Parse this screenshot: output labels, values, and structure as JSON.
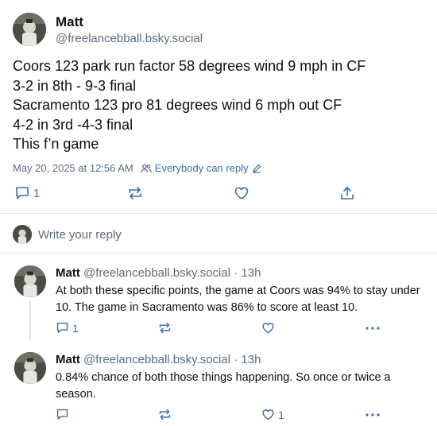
{
  "main_post": {
    "display_name": "Matt",
    "handle": "@freelancebball.bsky.social",
    "lines": [
      "Coors 123 park run factor 58 degrees wind 9 mph in CF",
      "3-2 in 8th - 9-3 final",
      "Sacramento 123 pro 81 degrees wind 6 mph out CF",
      "4-2 in 3rd -4-3 final",
      "This f’n game"
    ],
    "timestamp": "May 20, 2025 at 12:56 AM",
    "reply_permission": "Everybody can reply",
    "reply_count": "1"
  },
  "composer": {
    "placeholder": "Write your reply"
  },
  "replies": [
    {
      "display_name": "Matt",
      "handle": "@freelancebball.bsky.social",
      "age": "· 13h",
      "text": "At both these specific points, the game at Coors was 94% to stay under 10. The game in Sacramento was 86% to score at least 10.",
      "reply_count": "1",
      "like_count": ""
    },
    {
      "display_name": "Matt",
      "handle": "@freelancebball.bsky.social",
      "age": "· 13h",
      "text": "0.84% chance of both those things happening. So once or twice a season.",
      "reply_count": "",
      "like_count": "1"
    }
  ],
  "colors": {
    "accent": "#3b6fa8",
    "muted": "#5b6b7c",
    "border": "#e3e8ee"
  },
  "icons": [
    "reply-icon",
    "repost-icon",
    "like-icon",
    "share-icon",
    "more-icon",
    "people-icon",
    "pencil-icon"
  ]
}
